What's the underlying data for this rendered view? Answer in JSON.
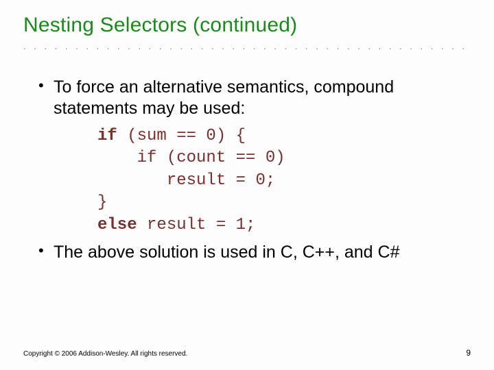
{
  "title": "Nesting Selectors (continued)",
  "bullets": {
    "b1": "To force an alternative semantics, compound statements may be used:",
    "b2": "The above solution is used in C, C++, and C#"
  },
  "code": {
    "l1_kw": "if",
    "l1_rest": " (sum == 0) {",
    "l2": "    if (count == 0)",
    "l3": "       result = 0;",
    "l4": "}",
    "l5_kw": "else",
    "l5_rest": " result = 1;"
  },
  "footer": "Copyright © 2006 Addison-Wesley. All rights reserved.",
  "page": "9",
  "dots": ". . . . . . . . . . . . . . . . . . . . . . . . . . . . . . . . . . . . . . . . . . . . . . . . . . . . . . . . . . . . . . . . . . . . . . . . . . . . . ."
}
